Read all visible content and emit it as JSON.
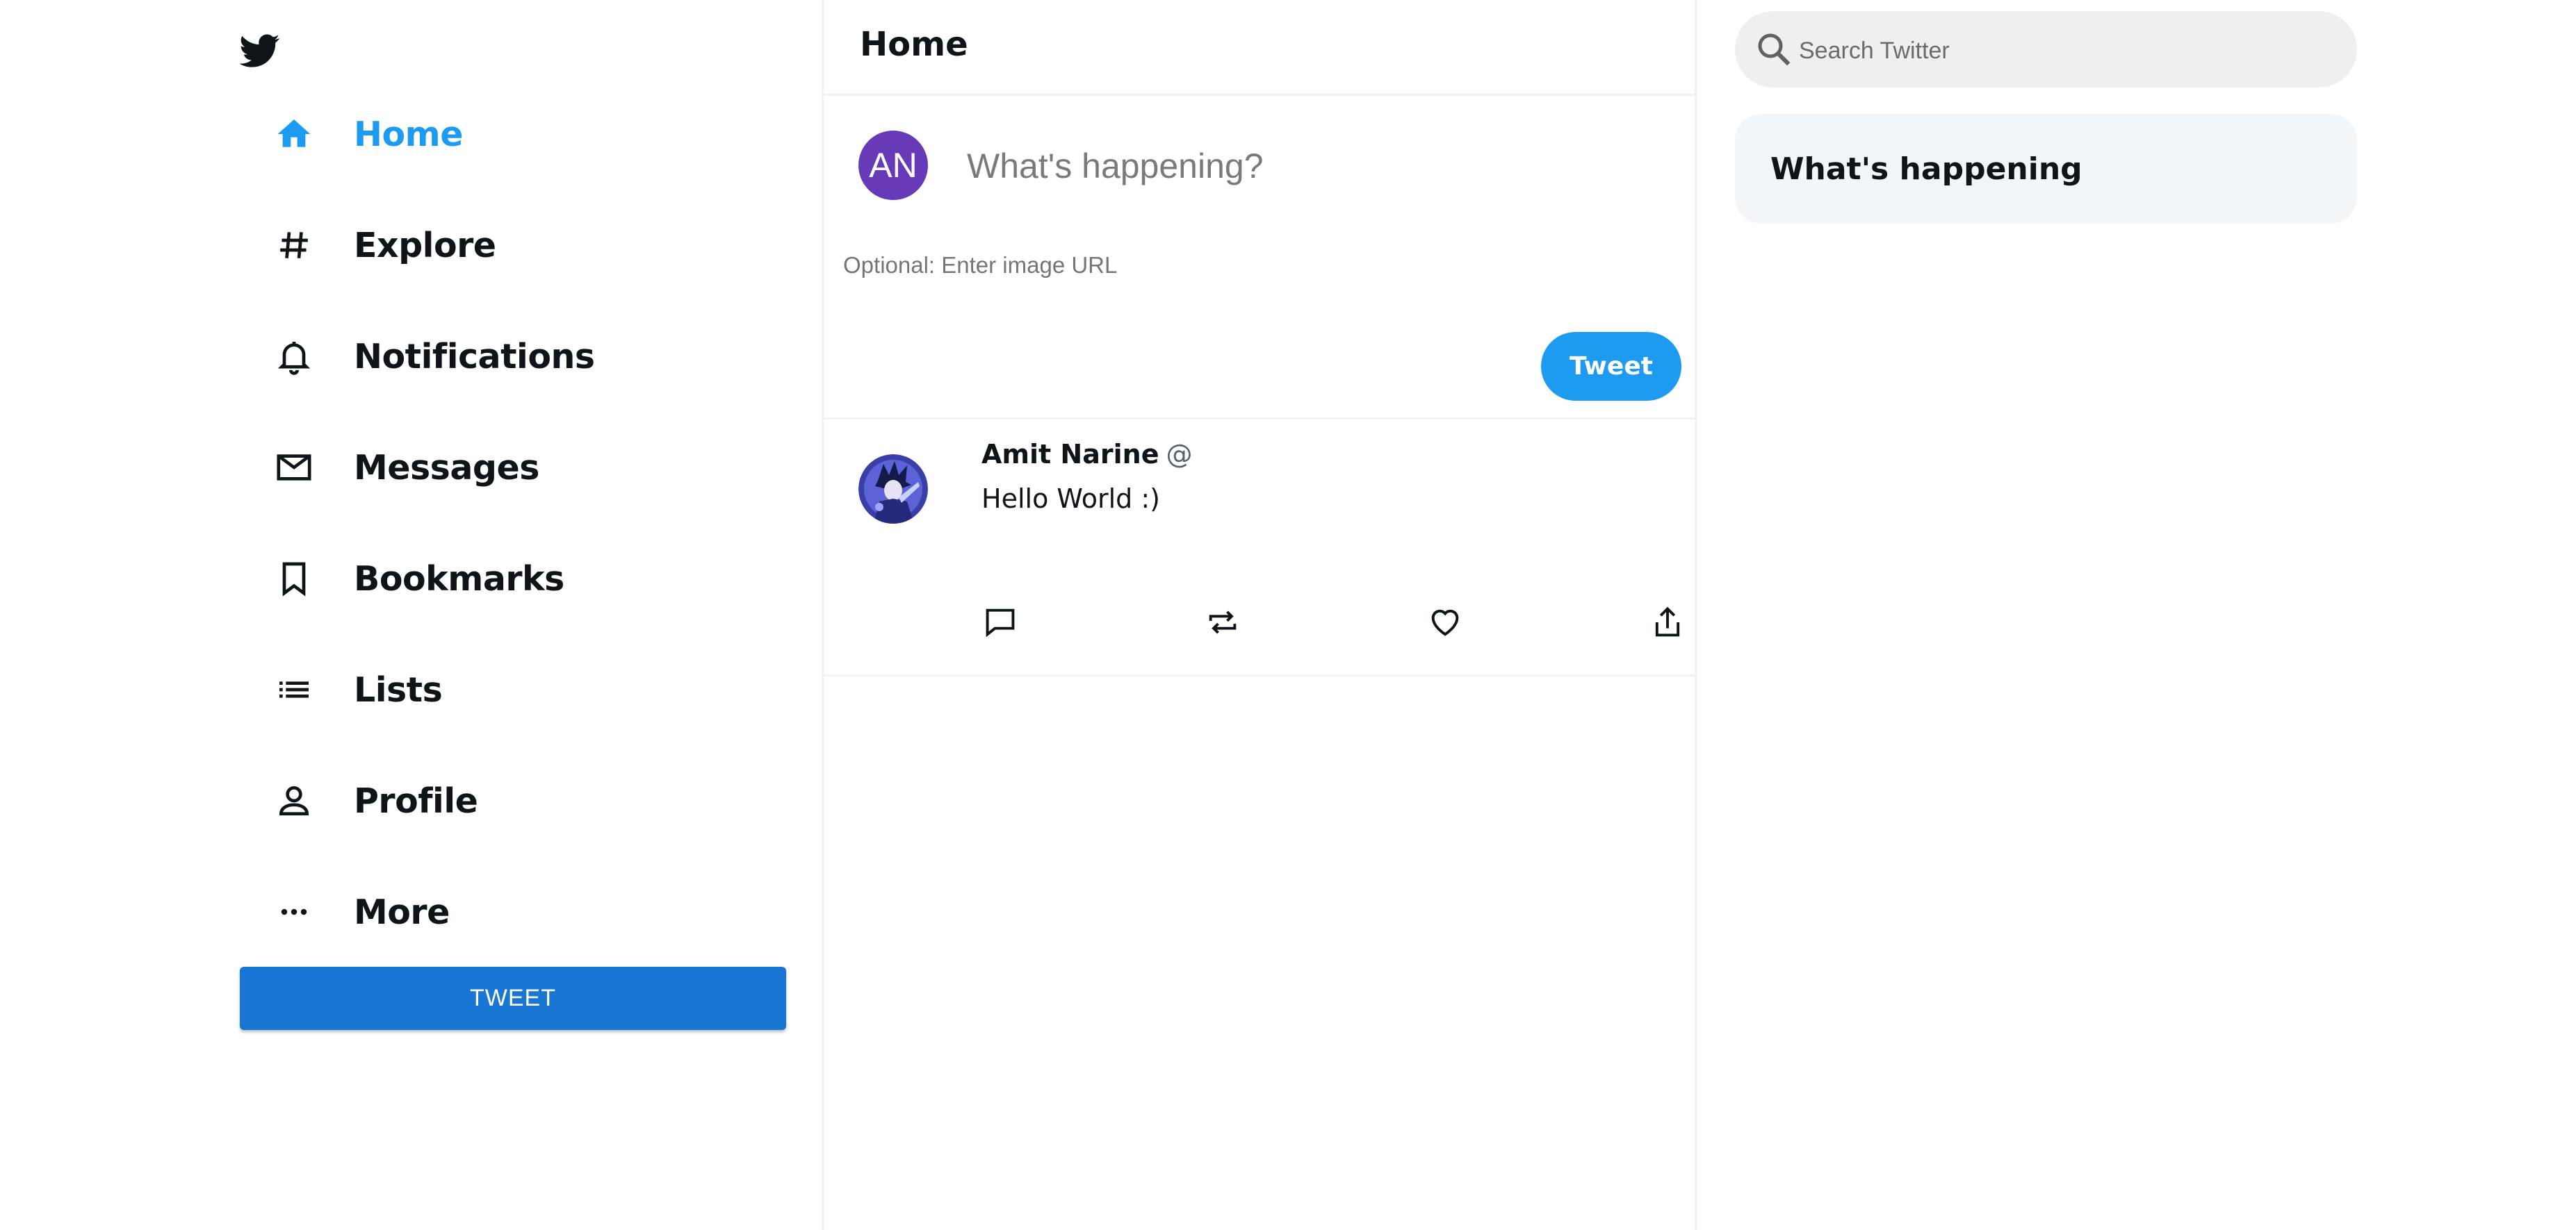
{
  "sidebar": {
    "logo": "twitter-bird-icon",
    "items": [
      {
        "label": "Home",
        "icon": "home-icon",
        "active": true
      },
      {
        "label": "Explore",
        "icon": "hashtag-icon",
        "active": false
      },
      {
        "label": "Notifications",
        "icon": "bell-icon",
        "active": false
      },
      {
        "label": "Messages",
        "icon": "mail-icon",
        "active": false
      },
      {
        "label": "Bookmarks",
        "icon": "bookmark-icon",
        "active": false
      },
      {
        "label": "Lists",
        "icon": "list-icon",
        "active": false
      },
      {
        "label": "Profile",
        "icon": "person-icon",
        "active": false
      },
      {
        "label": "More",
        "icon": "more-icon",
        "active": false
      }
    ],
    "tweet_button": "TWEET"
  },
  "feed": {
    "title": "Home",
    "composer": {
      "avatar_initials": "AN",
      "placeholder": "What's happening?",
      "image_url_placeholder": "Optional: Enter image URL",
      "tweet_button": "Tweet"
    },
    "posts": [
      {
        "author": "Amit Narine",
        "handle": "@",
        "text": "Hello World :)",
        "actions": [
          "reply-icon",
          "retweet-icon",
          "like-icon",
          "share-icon"
        ]
      }
    ]
  },
  "widgets": {
    "search_placeholder": "Search Twitter",
    "trends_title": "What's happening"
  },
  "colors": {
    "brand": "#1d9bf0",
    "sidebar_button": "#1976d2",
    "avatar": "#673ab7",
    "text": "#0f1419",
    "divider": "#eff3f4",
    "search_bg": "#efefef",
    "trends_bg": "#f3f6f8"
  }
}
